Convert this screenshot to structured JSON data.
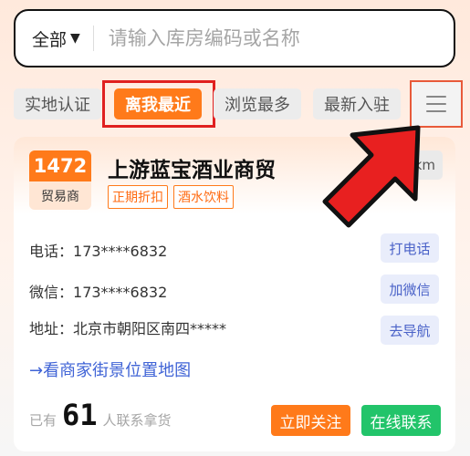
{
  "search": {
    "scope_label": "全部",
    "caret": "▼",
    "placeholder": "请输入库房编码或名称"
  },
  "tabs": [
    {
      "label": "实地认证",
      "active": false
    },
    {
      "label": "离我最近",
      "active": true
    },
    {
      "label": "浏览最多",
      "active": false
    },
    {
      "label": "最新入驻",
      "active": false
    }
  ],
  "menu_icon": "hamburger-menu-icon",
  "card": {
    "badge_number": "1472",
    "badge_type": "贸易商",
    "title": "上游蓝宝酒业商贸",
    "tags": [
      "正期折扣",
      "酒水饮料"
    ],
    "distance": "km",
    "phone_label": "电话：",
    "phone_value": "173****6832",
    "phone_button": "打电话",
    "wechat_label": "微信：",
    "wechat_value": "173****6832",
    "wechat_button": "加微信",
    "address_label": "地址：",
    "address_value": "北京市朝阳区南四*****",
    "address_button": "去导航",
    "map_link": "→看商家街景位置地图",
    "followers_prefix": "已有",
    "followers_count": "61",
    "followers_suffix": "人联系拿货",
    "follow_button": "立即关注",
    "contact_button": "在线联系"
  },
  "colors": {
    "accent": "#ff7a1a",
    "contact_green": "#22c46a",
    "link_blue": "#3f63d6",
    "annotation_red": "#e02020"
  }
}
